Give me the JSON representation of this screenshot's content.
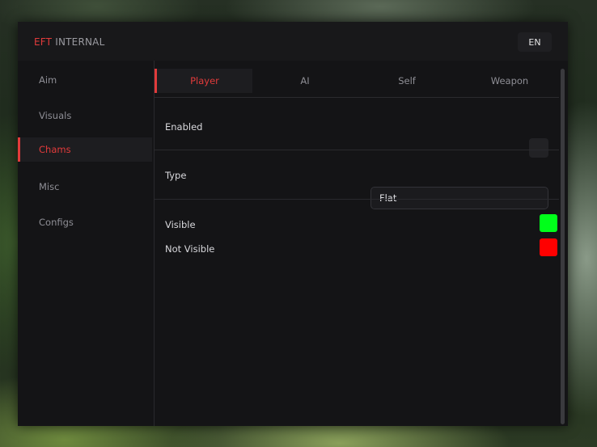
{
  "header": {
    "brand": "EFT",
    "subtitle": "INTERNAL",
    "language": "EN"
  },
  "sidebar": {
    "items": [
      {
        "label": "Aim"
      },
      {
        "label": "Visuals"
      },
      {
        "label": "Chams",
        "active": true
      },
      {
        "label": "Misc"
      },
      {
        "label": "Configs"
      }
    ]
  },
  "tabs": [
    {
      "label": "Player",
      "active": true
    },
    {
      "label": "AI"
    },
    {
      "label": "Self"
    },
    {
      "label": "Weapon"
    }
  ],
  "settings": {
    "enabled": {
      "label": "Enabled",
      "checked": false
    },
    "type": {
      "label": "Type",
      "value": "Flat"
    },
    "visible": {
      "label": "Visible",
      "color": "#00ff1a"
    },
    "not_visible": {
      "label": "Not Visible",
      "color": "#ff0000"
    }
  },
  "theme": {
    "accent": "#e23b3b",
    "background": "#141416"
  }
}
